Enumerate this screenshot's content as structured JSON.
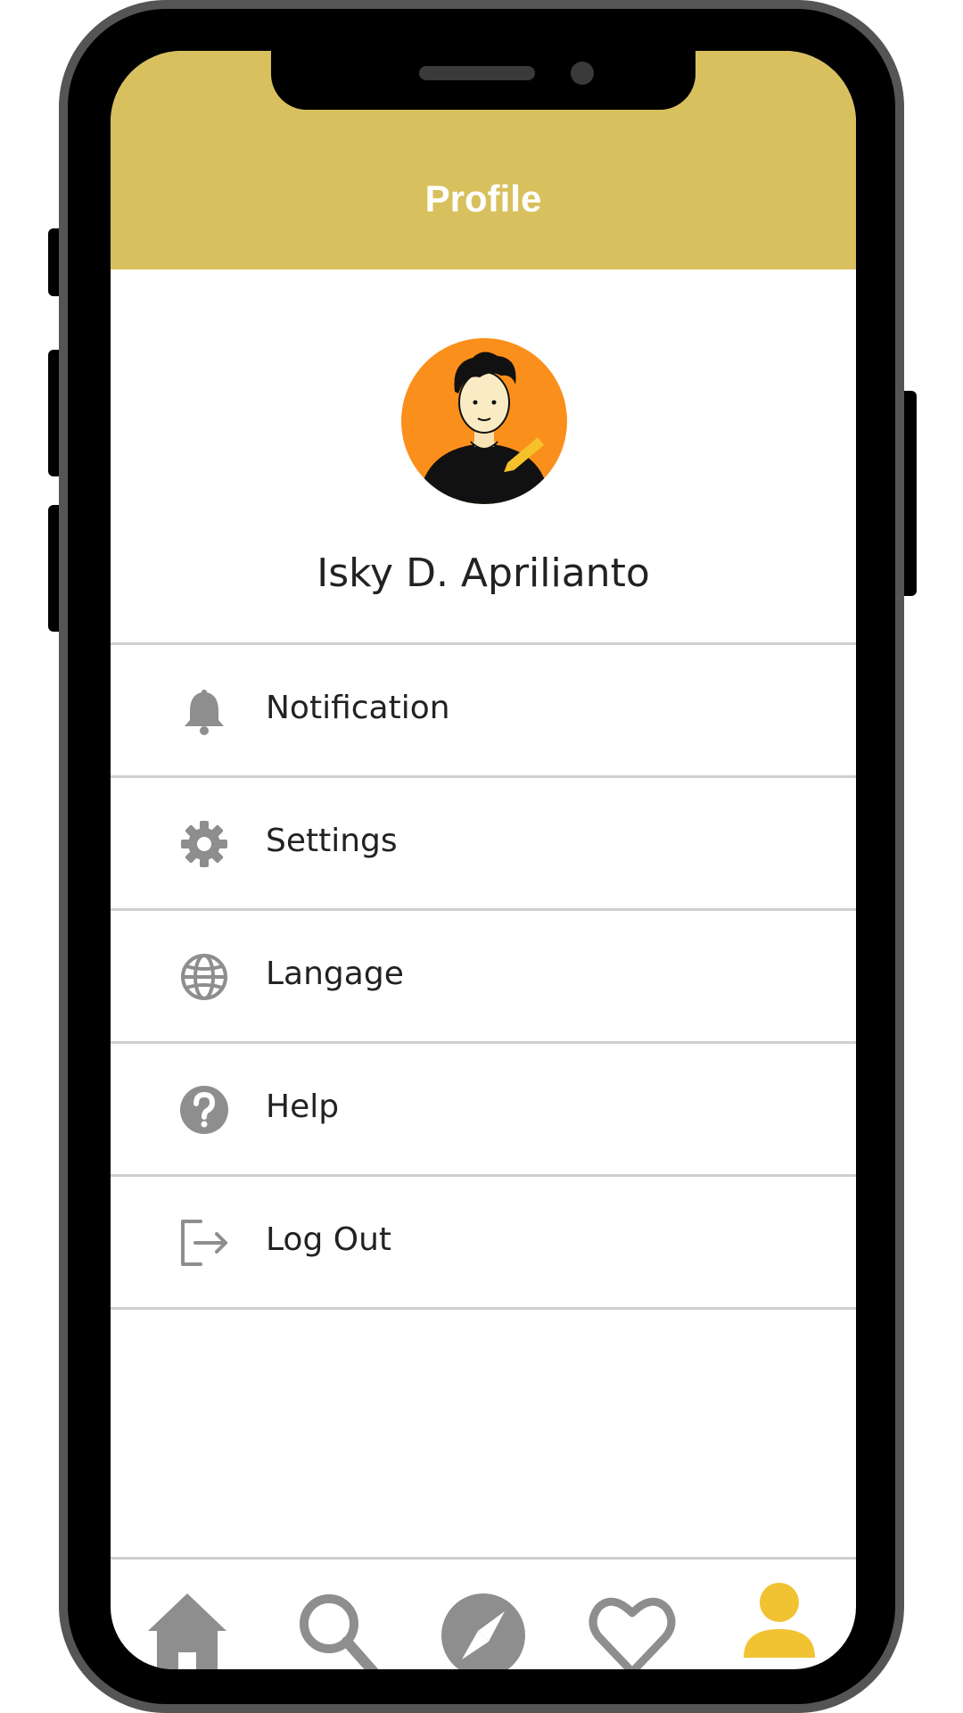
{
  "header": {
    "title": "Profile"
  },
  "profile": {
    "name": "Isky D. Aprilianto"
  },
  "menu": {
    "items": [
      {
        "label": "Notification",
        "icon": "bell-icon"
      },
      {
        "label": "Settings",
        "icon": "gear-icon"
      },
      {
        "label": "Langage",
        "icon": "globe-icon"
      },
      {
        "label": "Help",
        "icon": "help-icon"
      },
      {
        "label": "Log Out",
        "icon": "logout-icon"
      }
    ]
  },
  "nav": {
    "items": [
      {
        "icon": "home-icon"
      },
      {
        "icon": "search-icon"
      },
      {
        "icon": "compass-icon"
      },
      {
        "icon": "heart-icon"
      },
      {
        "icon": "user-icon",
        "active": true
      }
    ]
  },
  "colors": {
    "header": "#d8c05e",
    "avatar_bg": "#fb8f1b",
    "icon_gray": "#8e8e8e",
    "active": "#f1c232"
  }
}
